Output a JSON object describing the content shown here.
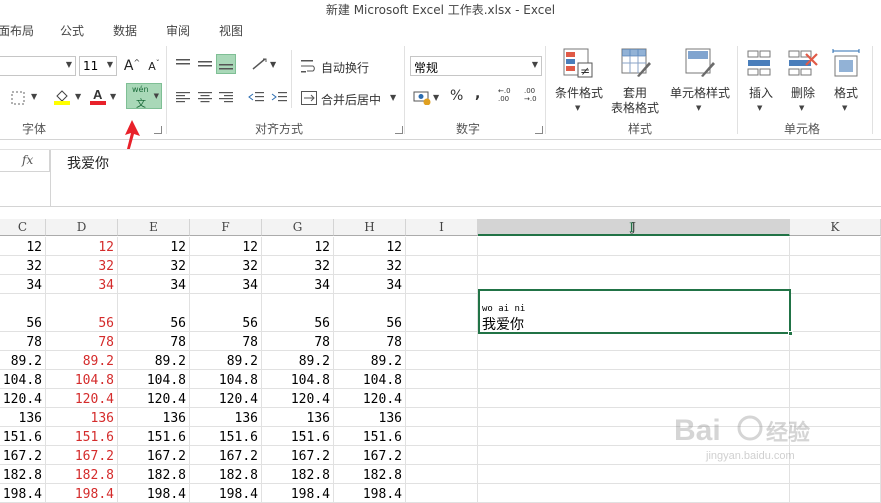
{
  "window": {
    "title": "新建 Microsoft Excel 工作表.xlsx - Excel"
  },
  "menu": {
    "items": [
      "面布局",
      "公式",
      "数据",
      "审阅",
      "视图"
    ]
  },
  "ribbon": {
    "font": {
      "size": "11",
      "grow_label": "A",
      "shrink_label": "A",
      "group_label": "字体",
      "phonetic_top": "wén",
      "phonetic_bottom": "文"
    },
    "alignment": {
      "wrap_label": "自动换行",
      "merge_label": "合并后居中",
      "group_label": "对齐方式"
    },
    "number": {
      "format_value": "常规",
      "percent": "%",
      "comma": ",",
      "inc_decimal": "←.0 .00",
      "dec_decimal": ".00 →.0",
      "group_label": "数字"
    },
    "styles": {
      "conditional_label": "条件格式",
      "table_label_1": "套用",
      "table_label_2": "表格格式",
      "cell_styles_label": "单元格样式",
      "group_label": "样式"
    },
    "cells": {
      "insert_label": "插入",
      "delete_label": "删除",
      "format_label": "格式",
      "group_label": "单元格"
    }
  },
  "formula_bar": {
    "fx": "fx",
    "value": "我爱你"
  },
  "grid": {
    "columns": [
      "C",
      "D",
      "E",
      "F",
      "G",
      "H",
      "I",
      "J",
      "K"
    ],
    "rows": [
      [
        "12",
        "12",
        "12",
        "12",
        "12",
        "12"
      ],
      [
        "32",
        "32",
        "32",
        "32",
        "32",
        "32"
      ],
      [
        "34",
        "34",
        "34",
        "34",
        "34",
        "34"
      ],
      [
        "56",
        "56",
        "56",
        "56",
        "56",
        "56"
      ],
      [
        "78",
        "78",
        "78",
        "78",
        "78",
        "78"
      ],
      [
        "89.2",
        "89.2",
        "89.2",
        "89.2",
        "89.2",
        "89.2"
      ],
      [
        "104.8",
        "104.8",
        "104.8",
        "104.8",
        "104.8",
        "104.8"
      ],
      [
        "120.4",
        "120.4",
        "120.4",
        "120.4",
        "120.4",
        "120.4"
      ],
      [
        "136",
        "136",
        "136",
        "136",
        "136",
        "136"
      ],
      [
        "151.6",
        "151.6",
        "151.6",
        "151.6",
        "151.6",
        "151.6"
      ],
      [
        "167.2",
        "167.2",
        "167.2",
        "167.2",
        "167.2",
        "167.2"
      ],
      [
        "182.8",
        "182.8",
        "182.8",
        "182.8",
        "182.8",
        "182.8"
      ],
      [
        "198.4",
        "198.4",
        "198.4",
        "198.4",
        "198.4",
        "198.4"
      ]
    ],
    "active_cell": {
      "phonetic": "wo ai ni",
      "text": "我爱你"
    }
  },
  "colors": {
    "accent_green": "#217346",
    "red_text": "#d42b2b",
    "arrow_red": "#e8212a"
  },
  "watermark": {
    "brand": "Baidu 经验",
    "url": "jingyan.baidu.com"
  }
}
